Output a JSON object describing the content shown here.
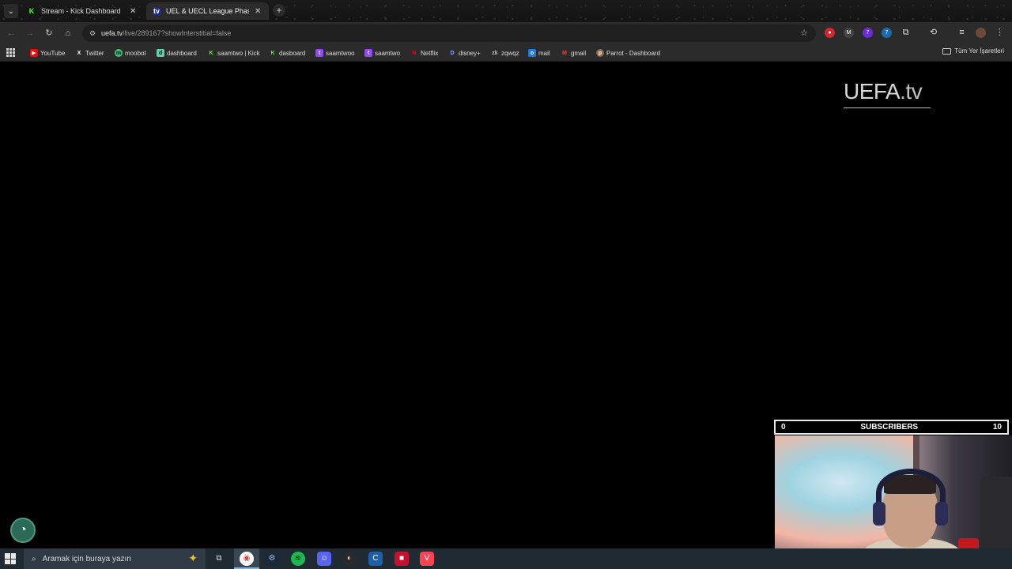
{
  "browser": {
    "tabs": [
      {
        "title": "Stream - Kick Dashboard",
        "favicon": "kick-icon",
        "active": false
      },
      {
        "title": "UEL & UECL League Phase Dra",
        "favicon": "uefa-icon",
        "active": true
      }
    ],
    "address": {
      "host": "uefa.tv",
      "path": "/live/289167?showInterstitial=false"
    },
    "bookmarks": [
      {
        "label": "YouTube",
        "icon": "youtube-icon",
        "color": "#ff0000"
      },
      {
        "label": "Twitter",
        "icon": "x-icon",
        "color": "#ffffff"
      },
      {
        "label": "moobot",
        "icon": "moobot-icon",
        "color": "#3fbf7f"
      },
      {
        "label": "dashboard",
        "icon": "dashboard-icon",
        "color": "#5fd3a8"
      },
      {
        "label": "saamtwo | Kick",
        "icon": "kick-icon",
        "color": "#53fc18"
      },
      {
        "label": "dasboard",
        "icon": "kick-icon",
        "color": "#53fc18"
      },
      {
        "label": "saamtwoo",
        "icon": "twitch-icon",
        "color": "#9146ff"
      },
      {
        "label": "saamtwo",
        "icon": "twitch-icon",
        "color": "#9146ff"
      },
      {
        "label": "Netflix",
        "icon": "netflix-icon",
        "color": "#e50914"
      },
      {
        "label": "disney+",
        "icon": "disney-icon",
        "color": "#8fa8ff"
      },
      {
        "label": "zqwqz",
        "icon": "zk-icon",
        "color": "#c0c0c0"
      },
      {
        "label": "mail",
        "icon": "outlook-icon",
        "color": "#1f7ae0"
      },
      {
        "label": "gmail",
        "icon": "gmail-icon",
        "color": "#ea4335"
      },
      {
        "label": "Parrot - Dashboard",
        "icon": "parrot-icon",
        "color": "#8a6a4a"
      }
    ],
    "bookmarks_folder": "Tüm Yer İşaretleri"
  },
  "page": {
    "logo": {
      "uefa": "UEFA",
      "dot": ".",
      "tv": "tv"
    }
  },
  "overlay": {
    "subscribers": {
      "current": "0",
      "label": "SUBSCRIBERS",
      "goal": "10"
    }
  },
  "taskbar": {
    "search_placeholder": "Aramak için buraya yazın",
    "apps": [
      "task-view-icon",
      "chrome-icon",
      "steam-icon",
      "spotify-icon",
      "discord-icon",
      "app-icon",
      "ccleaner-icon",
      "app-red-icon",
      "valorant-icon"
    ]
  }
}
